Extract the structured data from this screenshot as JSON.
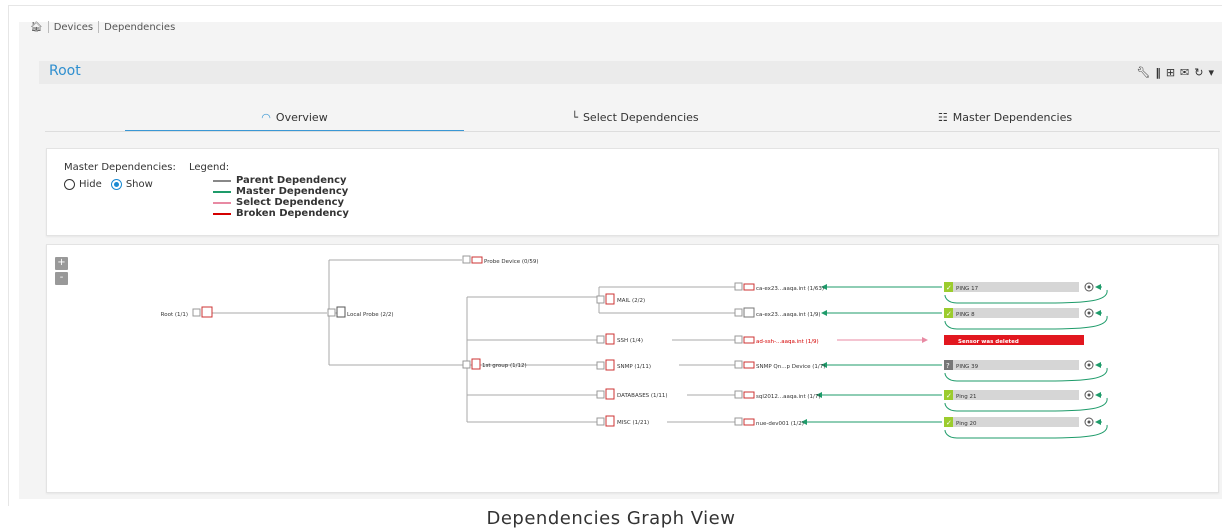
{
  "breadcrumb": {
    "items": [
      "Devices",
      "Dependencies"
    ]
  },
  "header": {
    "title": "Root",
    "icons": [
      "wrench-icon",
      "pause-icon",
      "add-icon",
      "mail-icon",
      "refresh-icon",
      "dropdown-icon"
    ]
  },
  "tabs": [
    {
      "label": "Overview",
      "icon": "gauge-icon",
      "active": true
    },
    {
      "label": "Select Dependencies",
      "icon": "tree-icon",
      "active": false
    },
    {
      "label": "Master Dependencies",
      "icon": "hierarchy-icon",
      "active": false
    }
  ],
  "options": {
    "master_label": "Master Dependencies:",
    "hide_label": "Hide",
    "show_label": "Show",
    "selected": "Show"
  },
  "legend": {
    "title": "Legend:",
    "items": [
      {
        "label": "Parent Dependency",
        "color": "#888888"
      },
      {
        "label": "Master Dependency",
        "color": "#1e9b6a"
      },
      {
        "label": "Select Dependency",
        "color": "#e88aa3"
      },
      {
        "label": "Broken Dependency",
        "color": "#d40000"
      }
    ]
  },
  "zoom": {
    "in": "+",
    "out": "-"
  },
  "graph": {
    "root": "Root (1/1)",
    "local_probe": "Local Probe (2/2)",
    "probe_device": "Probe Device (0/59)",
    "group": "1st group (1/12)",
    "subgroups": [
      "MAIL (2/2)",
      "SSH (1/4)",
      "SNMP (1/11)",
      "DATABASES (1/11)",
      "MISC (1/21)"
    ],
    "devices": [
      "ca-ex23...aaqa.int (1/63)",
      "ca-ex23...aaqa.int (1/9)",
      "ad-ssh-...aaqa.int (1/9)",
      "SNMP Qn...p Device (1/7)",
      "sql2012...aaqa.int (1/7)",
      "nue-dev001 (1/2)"
    ],
    "sensors": [
      {
        "label": "PING 17",
        "status": "ok"
      },
      {
        "label": "PING 8",
        "status": "ok"
      },
      {
        "label": "Sensor was deleted",
        "status": "deleted"
      },
      {
        "label": "PING 39",
        "status": "unknown"
      },
      {
        "label": "Ping 21",
        "status": "ok"
      },
      {
        "label": "Ping 20",
        "status": "ok"
      }
    ]
  },
  "caption": "Dependencies Graph View"
}
